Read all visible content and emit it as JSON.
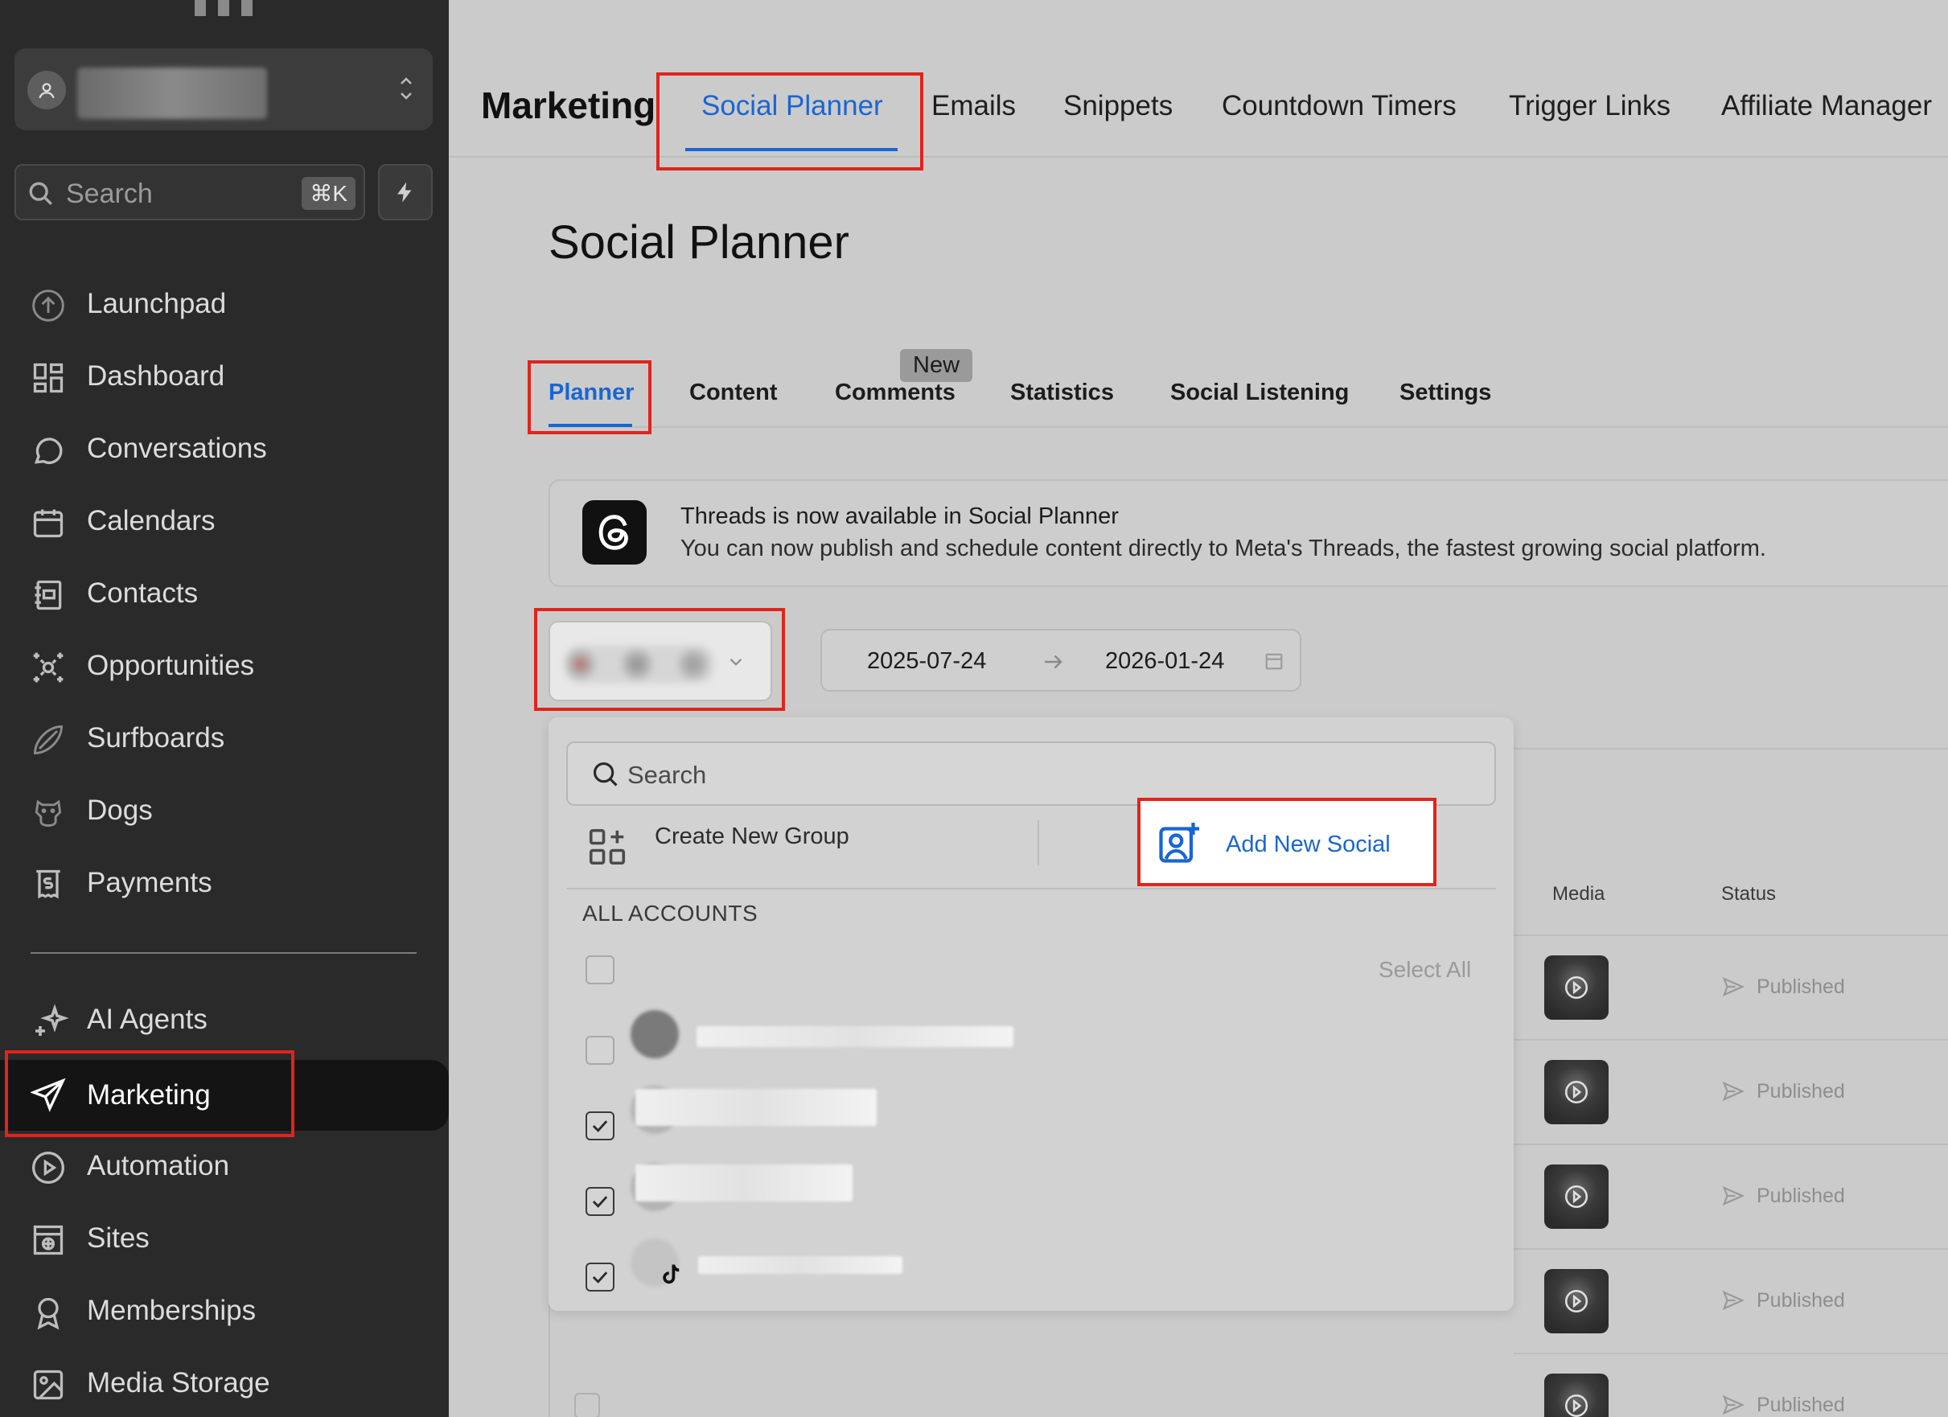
{
  "sidebar": {
    "search": {
      "placeholder": "Search",
      "shortcut": "⌘K"
    },
    "items": [
      {
        "label": "Launchpad",
        "icon": "launchpad-icon"
      },
      {
        "label": "Dashboard",
        "icon": "dashboard-icon"
      },
      {
        "label": "Conversations",
        "icon": "chat-icon"
      },
      {
        "label": "Calendars",
        "icon": "calendar-icon"
      },
      {
        "label": "Contacts",
        "icon": "contacts-icon"
      },
      {
        "label": "Opportunities",
        "icon": "opportunities-icon"
      },
      {
        "label": "Surfboards",
        "icon": "surfboard-icon"
      },
      {
        "label": "Dogs",
        "icon": "dog-icon"
      },
      {
        "label": "Payments",
        "icon": "payments-icon"
      }
    ],
    "items2": [
      {
        "label": "AI Agents",
        "icon": "sparkle-icon"
      },
      {
        "label": "Marketing",
        "icon": "send-icon",
        "active": true
      },
      {
        "label": "Automation",
        "icon": "automation-icon"
      },
      {
        "label": "Sites",
        "icon": "sites-icon"
      },
      {
        "label": "Memberships",
        "icon": "memberships-icon"
      },
      {
        "label": "Media Storage",
        "icon": "image-icon"
      }
    ]
  },
  "header": {
    "app_title": "Marketing",
    "tabs": [
      "Social Planner",
      "Emails",
      "Snippets",
      "Countdown Timers",
      "Trigger Links",
      "Affiliate Manager"
    ],
    "active_tab": "Social Planner"
  },
  "page": {
    "title": "Social Planner",
    "subtabs": [
      "Planner",
      "Content",
      "Comments",
      "Statistics",
      "Social Listening",
      "Settings"
    ],
    "new_badge": "New",
    "active_subtab": "Planner"
  },
  "banner": {
    "title": "Threads is now available in Social Planner",
    "subtitle": "You can now publish and schedule content directly to Meta's Threads, the fastest growing social platform."
  },
  "date_range": {
    "start": "2025-07-24",
    "end": "2026-01-24"
  },
  "dropdown": {
    "search_placeholder": "Search",
    "create_group": "Create New Group",
    "add_social": "Add New Social",
    "section_label": "ALL ACCOUNTS",
    "select_all": "Select All",
    "accounts_checked": [
      false,
      true,
      true,
      true
    ]
  },
  "table": {
    "columns": [
      "Media",
      "Status"
    ],
    "rows": [
      {
        "status": "Published"
      },
      {
        "status": "Published"
      },
      {
        "status": "Published"
      },
      {
        "status": "Published"
      },
      {
        "status": "Published"
      }
    ]
  },
  "colors": {
    "accent": "#1a66d2",
    "highlight": "#e0241c",
    "sidebar_bg": "#2a2a2a"
  }
}
